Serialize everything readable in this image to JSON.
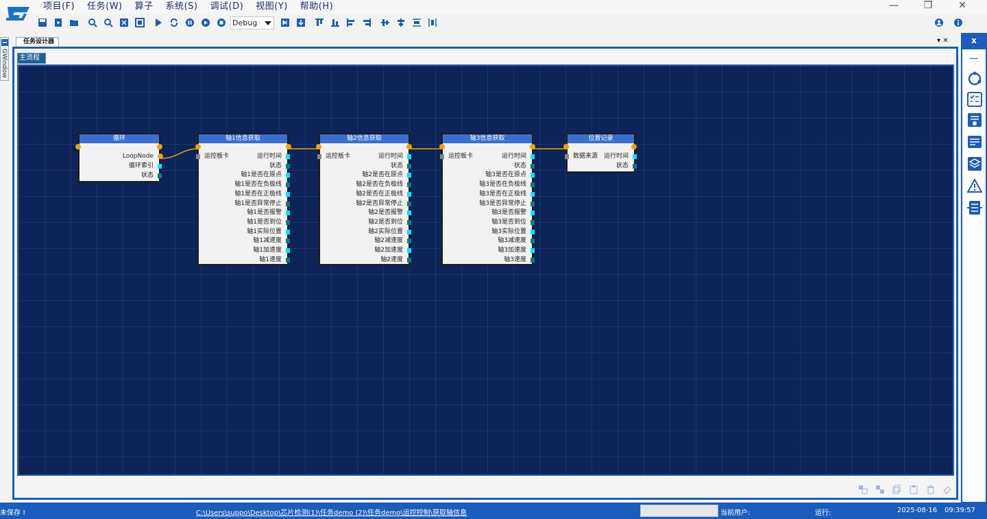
{
  "menu": [
    "项目(F)",
    "任务(W)",
    "算子",
    "系统(S)",
    "调试(D)",
    "视图(Y)",
    "帮助(H)"
  ],
  "toolbar": {
    "mode": "Debug"
  },
  "left_dock": {
    "label": "GWindow"
  },
  "document": {
    "tab": "任务设计器",
    "controls": "▾ ✕",
    "subtab": "主流程"
  },
  "nodes": {
    "loop": {
      "title": "循环",
      "outputs": [
        "LoopNode",
        "循环索引",
        "状态"
      ]
    },
    "axis1": {
      "title": "轴1信息获取",
      "input": "运控板卡",
      "outputs": [
        "运行时间",
        "状态",
        "轴1是否在原点",
        "轴1是否在负极线",
        "轴1是否在正极线",
        "轴1是否异常停止",
        "轴1是否报警",
        "轴1是否到位",
        "轴1实际位置",
        "轴1减速度",
        "轴1加速度",
        "轴1速度"
      ]
    },
    "axis2": {
      "title": "轴2信息获取",
      "input": "运控板卡",
      "outputs": [
        "运行时间",
        "状态",
        "轴2是否在原点",
        "轴2是否在负极线",
        "轴2是否在正极线",
        "轴2是否异常停止",
        "轴2是否报警",
        "轴2是否到位",
        "轴2实际位置",
        "轴2减速度",
        "轴2加速度",
        "轴2速度"
      ]
    },
    "axis3": {
      "title": "轴3信息获取",
      "input": "运控板卡",
      "outputs": [
        "运行时间",
        "状态",
        "轴3是否在原点",
        "轴3是否在负极线",
        "轴3是否在正极线",
        "轴3是否异常停止",
        "轴3是否报警",
        "轴3是否到位",
        "轴3实际位置",
        "轴3减速度",
        "轴3加速度",
        "轴3速度"
      ]
    },
    "record": {
      "title": "位置记录",
      "input": "数据来源",
      "outputs": [
        "运行时间",
        "状态"
      ]
    }
  },
  "status": {
    "save": "未保存 !",
    "path": "C:\\Users\\suppo\\Desktop\\芯片检测(1)\\任务demo (2)\\任务demo\\运控控制\\获取轴信息",
    "user_label": "当前用户:",
    "run_label": "运行:",
    "date": "2025-08-16",
    "time": "09:39:57"
  },
  "colors": {
    "accent": "#1b5cbc",
    "canvas": "#0c2457",
    "node_header": "#3a6fd0",
    "wire": "#f5a000"
  }
}
